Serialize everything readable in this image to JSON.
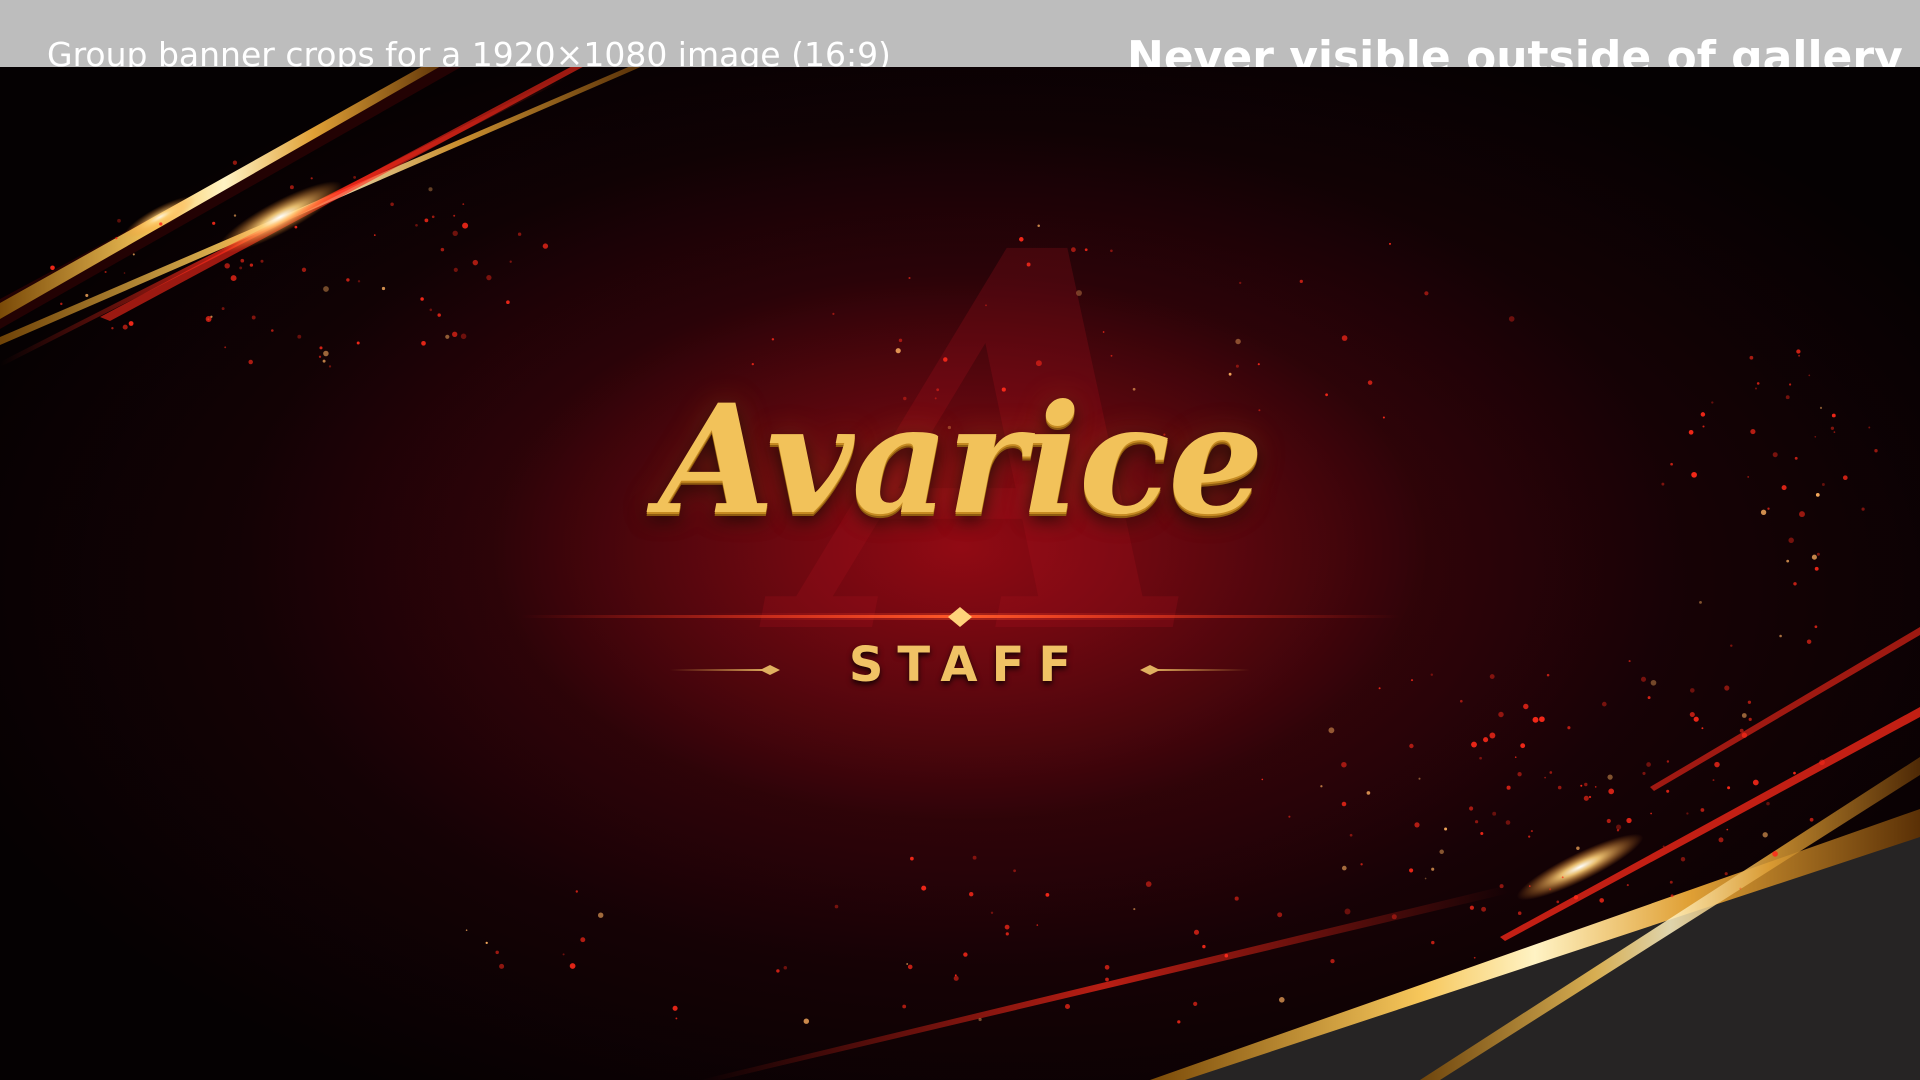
{
  "header": {
    "crop_caption": "Group banner crops for a 1920×1080 image (16:9)",
    "gallery_caption": "Never visible outside of gallery"
  },
  "banner": {
    "title": "Avarice",
    "subtitle": "STAFF",
    "watermark_letter": "A"
  },
  "colors": {
    "background_dark": "#050102",
    "crimson": "#8e0a16",
    "gold": "#f2c25a",
    "accent_red": "#ff2a1a"
  }
}
